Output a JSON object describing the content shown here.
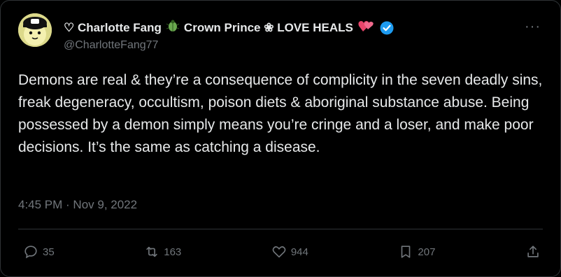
{
  "user": {
    "display_name_prefix": "♡ Charlotte Fang",
    "display_name_middle": "Crown Prince ❀ LOVE HEALS",
    "handle": "@CharlotteFang77",
    "bug_icon": "bug-icon",
    "heart_icon": "heart-with-ribbon-icon",
    "verified_icon": "verified-badge-icon",
    "verified_color": "#1d9bf0"
  },
  "tweet": {
    "text": "Demons are real & they’re a consequence of complicity in the seven deadly sins, freak degeneracy, occultism, poison diets & aboriginal substance abuse. Being possessed by a demon simply means you’re cringe and a loser, and make poor decisions. It’s the same as catching a disease.",
    "timestamp": "4:45 PM · Nov 9, 2022"
  },
  "actions": {
    "replies": "35",
    "retweets": "163",
    "likes": "944",
    "bookmarks": "207"
  },
  "more_label": "···"
}
